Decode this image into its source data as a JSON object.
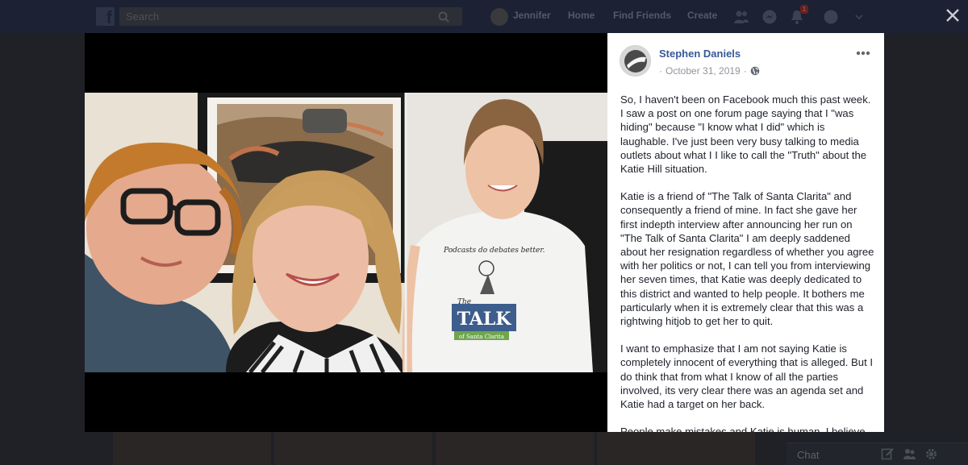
{
  "topbar": {
    "search_placeholder": "Search",
    "user_name": "Jennifer",
    "nav_home": "Home",
    "nav_find_friends": "Find Friends",
    "nav_create": "Create",
    "notification_count": "1"
  },
  "post": {
    "author": "Stephen Daniels",
    "date": "October 31, 2019",
    "meta_prefix": "·",
    "meta_suffix": "·",
    "audience_icon": "globe-icon",
    "paragraphs": [
      "So, I haven't been on Facebook much this past week. I saw a post on one forum page saying that I \"was hiding\" because \"I know what I did\" which is laughable. I've just been very busy talking to media outlets about what I I like to call the \"Truth\" about the Katie Hill situation.",
      "Katie is a friend of \"The Talk of Santa Clarita\" and consequently a friend of mine. In fact she gave her first indepth interview after announcing her run on \"The Talk of Santa Clarita\" I am deeply saddened about her resignation regardless of whether you agree with her politics or not, I can tell you from interviewing her seven times, that Katie was deeply dedicated to this district and wanted to help people. It bothers me particularly when it is extremely clear that this was a rightwing hitjob to get her to quit.",
      "I want to emphasize that I am not saying Katie is completely innocent of everything that is alleged. But I do think that from what I know of all the parties involved, its very clear there was an agenda set and Katie had a target on her back.",
      "People make mistakes and Katie is human. I believe"
    ]
  },
  "photo": {
    "shirt_line1": "Podcasts do debates better.",
    "shirt_line2": "The",
    "shirt_line3": "TALK",
    "shirt_line4": "of Santa Clarita"
  },
  "chat": {
    "label": "Chat"
  },
  "colors": {
    "fb_link": "#385898",
    "topbar": "#1c2233",
    "overlay_bg": "#1f2126"
  }
}
